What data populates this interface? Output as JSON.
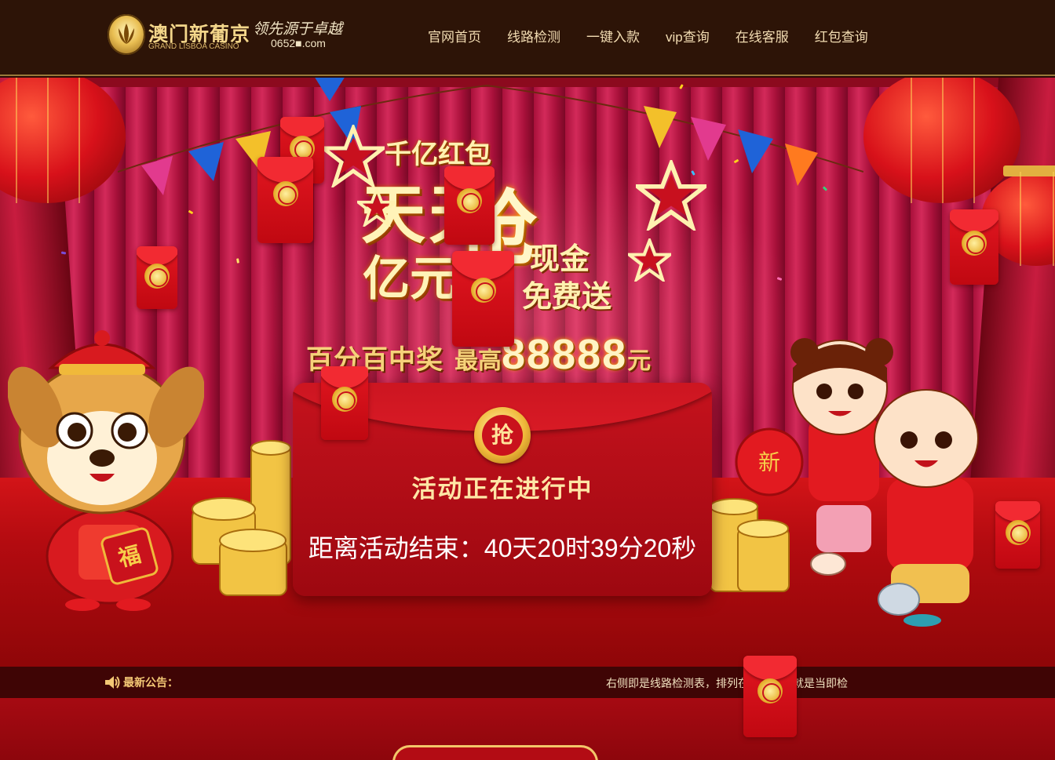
{
  "header": {
    "logo": {
      "name_cn": "澳门新葡京",
      "name_en": "GRAND LISBOA CASINO",
      "slogan": "领先源于卓越",
      "domain": "0652■.com"
    },
    "nav": [
      {
        "label": "官网首页"
      },
      {
        "label": "线路检测"
      },
      {
        "label": "一键入款"
      },
      {
        "label": "vip查询"
      },
      {
        "label": "在线客服"
      },
      {
        "label": "红包查询"
      }
    ]
  },
  "banner": {
    "headline_small": "千亿红包",
    "headline_big_1": "天天",
    "headline_big_2": "抢",
    "headline_row": "亿元",
    "headline_side_1": "现金",
    "headline_side_2": "免费送",
    "prize_label": "百分百中奖",
    "prize_max": "最高",
    "prize_amount": "88888",
    "prize_unit": "元"
  },
  "envelope": {
    "seal_label": "抢",
    "status": "活动正在进行中",
    "countdown": "距离活动结束：40天20时39分20秒"
  },
  "notice": {
    "label": "最新公告：",
    "text": "右侧即是线路检测表，排列在最前端的就是当即检"
  },
  "colors": {
    "header_bg": "#2d1407",
    "nav_text": "#f2dcb2",
    "curtain": "#c81c3f",
    "envelope": "#c5121d",
    "gold": "#f0b93a",
    "notice_bg": "#3f0505"
  }
}
